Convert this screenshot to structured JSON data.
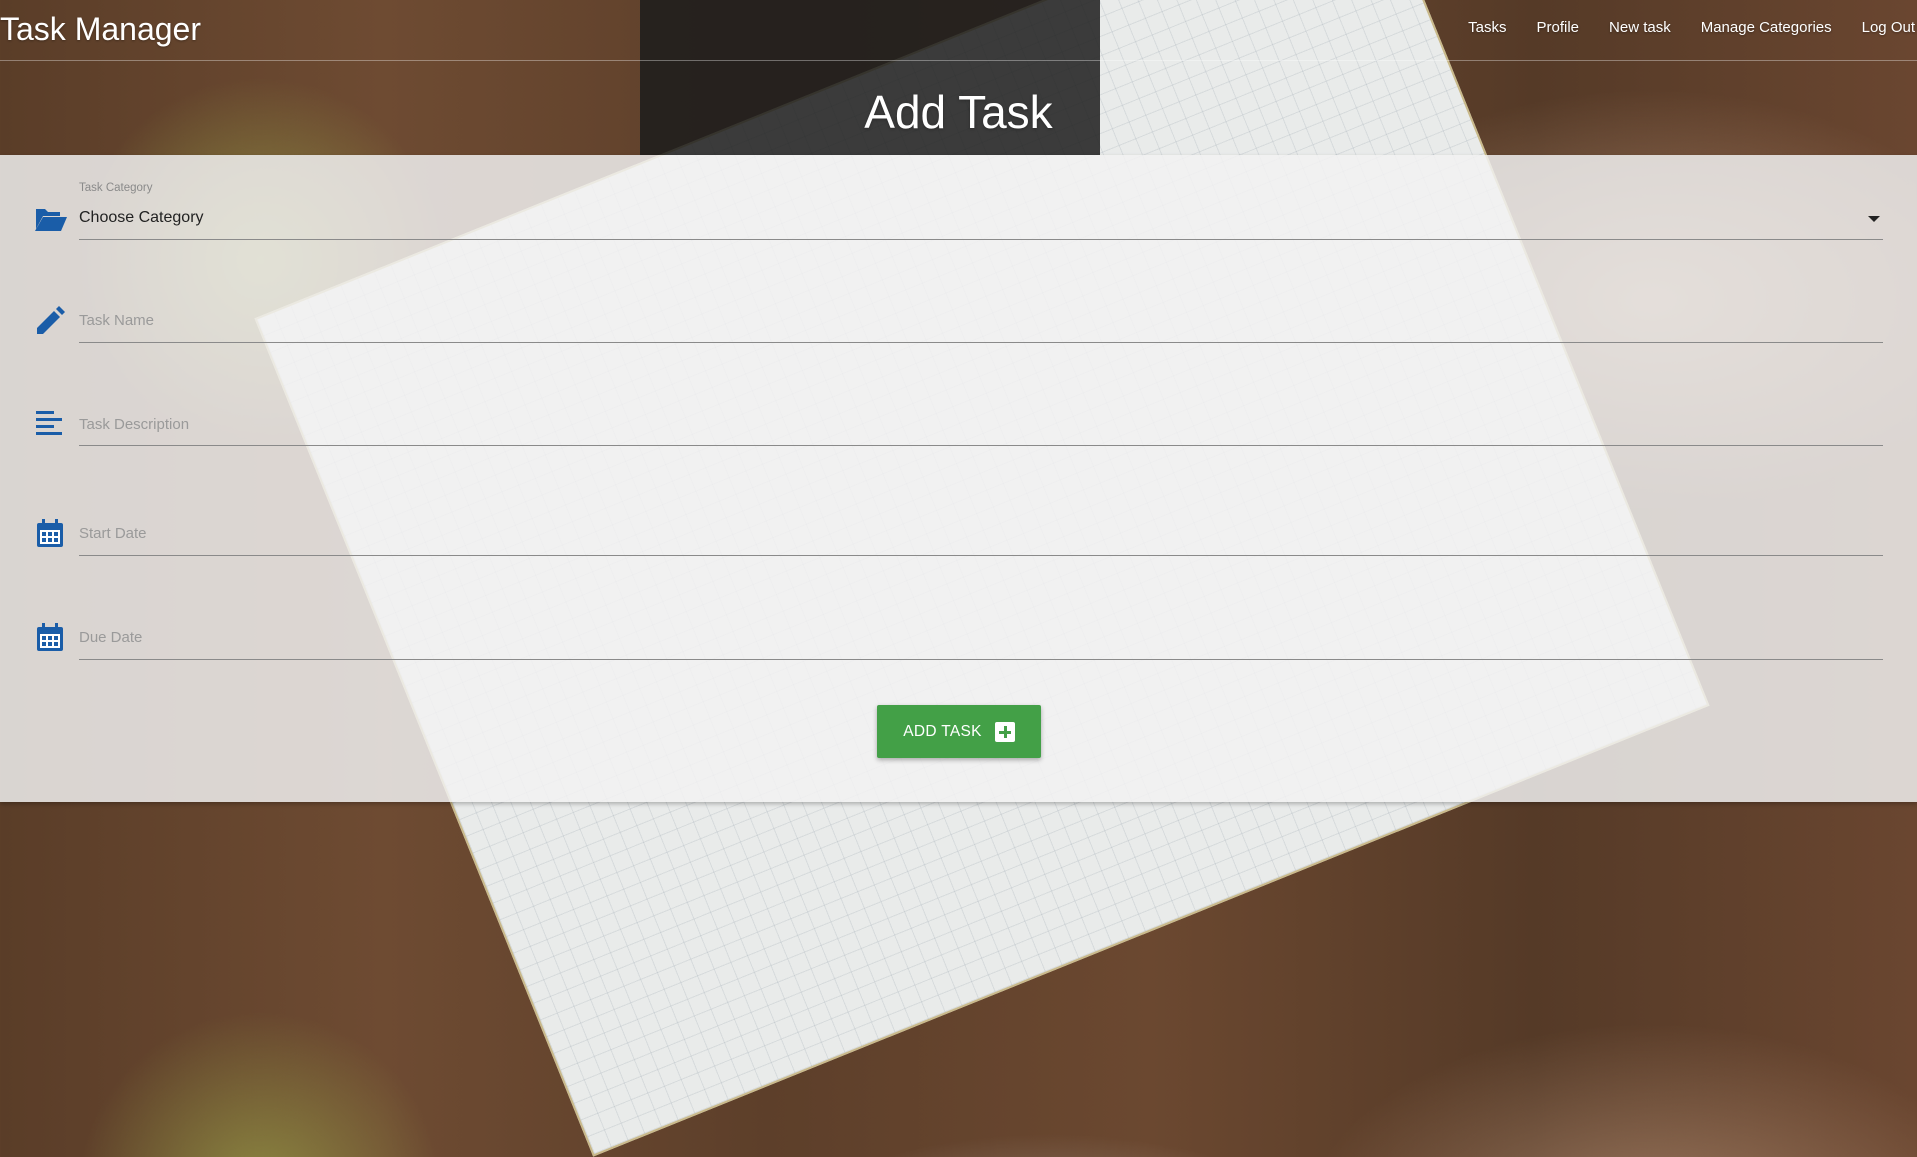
{
  "navbar": {
    "brand": "Task Manager",
    "links": [
      "Tasks",
      "Profile",
      "New task",
      "Manage Categories",
      "Log Out"
    ]
  },
  "page": {
    "title": "Add Task"
  },
  "form": {
    "category": {
      "label": "Task Category",
      "value": "Choose Category",
      "icon": "folder-open-icon"
    },
    "task_name": {
      "placeholder": "Task Name",
      "icon": "pencil-icon"
    },
    "task_description": {
      "placeholder": "Task Description",
      "icon": "align-left-icon"
    },
    "start_date": {
      "placeholder": "Start Date",
      "icon": "calendar-icon"
    },
    "due_date": {
      "placeholder": "Due Date",
      "icon": "calendar-icon"
    },
    "submit_label": "ADD TASK"
  },
  "colors": {
    "accent": "#1a5da8",
    "button": "#43a047"
  }
}
